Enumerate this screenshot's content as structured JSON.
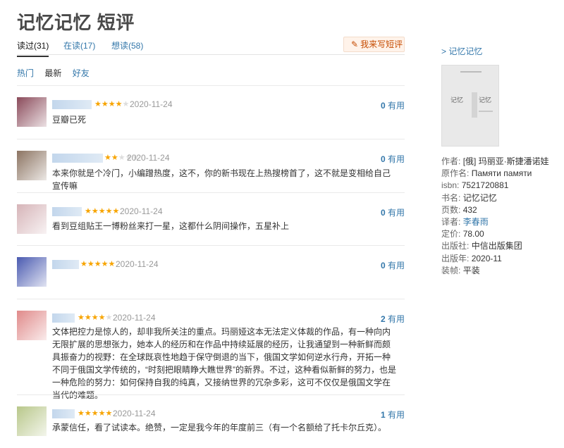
{
  "page_title": "记忆记忆 短评",
  "tabs": [
    {
      "label": "读过(31)",
      "active": true
    },
    {
      "label": "在读(17)",
      "active": false
    },
    {
      "label": "想读(58)",
      "active": false
    }
  ],
  "write_button": {
    "icon": "pencil-icon",
    "label": "我来写短评"
  },
  "sort_options": [
    "热门",
    "最新",
    "好友"
  ],
  "comments": [
    {
      "stars": 4,
      "date": "2020-11-24",
      "useful_count": "0",
      "useful_label": "有用",
      "text": "豆瓣已死",
      "avatar_color": "#8a4a5a"
    },
    {
      "stars": 2,
      "date": "2020-11-24",
      "useful_count": "0",
      "useful_label": "有用",
      "text": "本来你就是个冷门，小编蹭热度，这不，你的新书现在上热搜榜首了，这不就是变相给自己宣传嘛",
      "avatar_color": "#8c7462"
    },
    {
      "stars": 5,
      "date": "2020-11-24",
      "useful_count": "0",
      "useful_label": "有用",
      "text": "看到豆组贴王一博粉丝来打一星，这都什么阴间操作，五星补上",
      "avatar_color": "#d6b4b8"
    },
    {
      "stars": 5,
      "date": "2020-11-24",
      "useful_count": "0",
      "useful_label": "有用",
      "text": "",
      "avatar_color": "#4a5ab0"
    },
    {
      "stars": 4,
      "date": "2020-11-24",
      "useful_count": "2",
      "useful_label": "有用",
      "text": "文体把控力是惊人的，却非我所关注的重点。玛丽娅这本无法定义体裁的作品，有一种向内无限扩展的思想张力，她本人的经历和在作品中持续延展的经历，让我通望到一种新鲜而颇具振奋力的视野：在全球既哀性地趋于保守倒退的当下，俄国文学如何逆水行舟，开拓一种不同于俄国文学传统的，“时刻把眼睛睁大瞧世界”的新界。不过，这种看似新鲜的努力，也是一种危险的努力：如何保持自我的纯真，又接纳世界的冗杂多彩，这可不仅仅是俄国文学在当代的难题。",
      "avatar_color": "#e08a8a"
    },
    {
      "stars": 5,
      "date": "2020-11-24",
      "useful_count": "1",
      "useful_label": "有用",
      "text": "承蒙信任，看了试读本。绝赞，一定是我今年的年度前三（有一个名额给了托卡尔丘克）。",
      "avatar_color": "#b8c78a"
    }
  ],
  "sidebar": {
    "back_link": "> 记忆记忆",
    "cover_text_1": "记忆",
    "cover_text_2": "记忆",
    "info": [
      {
        "label": "作者:",
        "value": "[俄] 玛丽亚·斯捷潘诺娃",
        "link": false
      },
      {
        "label": "原作名:",
        "value": "Памяти памяти",
        "link": false
      },
      {
        "label": "isbn:",
        "value": "7521720881",
        "link": false
      },
      {
        "label": "书名:",
        "value": "记忆记忆",
        "link": false
      },
      {
        "label": "页数:",
        "value": "432",
        "link": false
      },
      {
        "label": "译者:",
        "value": "李春雨",
        "link": true
      },
      {
        "label": "定价:",
        "value": "78.00",
        "link": false
      },
      {
        "label": "出版社:",
        "value": "中信出版集团",
        "link": false
      },
      {
        "label": "出版年:",
        "value": "2020-11",
        "link": false
      },
      {
        "label": "装帧:",
        "value": "平装",
        "link": false
      }
    ]
  }
}
